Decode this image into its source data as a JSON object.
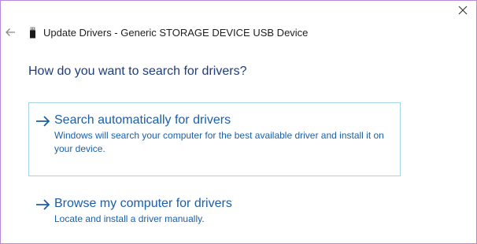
{
  "window": {
    "title": "Update Drivers - Generic STORAGE DEVICE USB Device",
    "close_glyph": "×",
    "back_icon": "back-arrow-icon",
    "device_icon": "usb-device-icon"
  },
  "main": {
    "heading": "How do you want to search for drivers?",
    "accent_color": "#1a5faa",
    "options": [
      {
        "title": "Search automatically for drivers",
        "description": "Windows will search your computer for the best available driver and install it on your device.",
        "icon": "right-arrow-icon"
      },
      {
        "title": "Browse my computer for drivers",
        "description": "Locate and install a driver manually.",
        "icon": "right-arrow-icon"
      }
    ]
  }
}
